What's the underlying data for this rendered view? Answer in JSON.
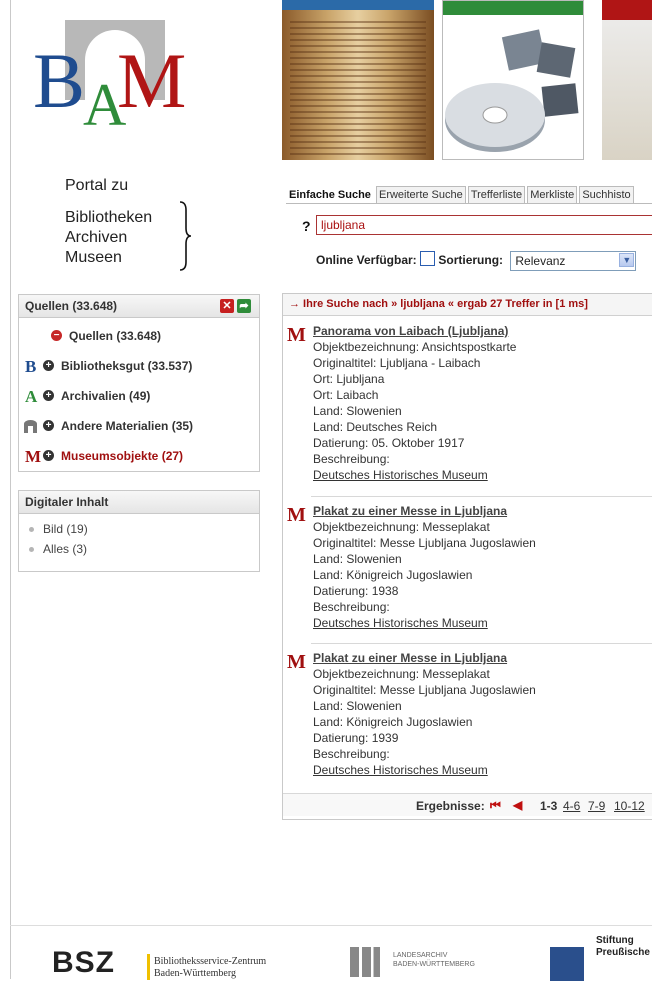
{
  "logo": {
    "text": "BAM"
  },
  "portal": {
    "line1": "Portal zu",
    "items": [
      "Bibliotheken",
      "Archiven",
      "Museen"
    ]
  },
  "tabs": [
    "Einfache Suche",
    "Erweiterte Suche",
    "Trefferliste",
    "Merkliste",
    "Suchhisto"
  ],
  "search": {
    "help": "?",
    "query": "ljubljana"
  },
  "options": {
    "online_label": "Online Verfügbar:",
    "sort_label": "Sortierung:",
    "sort_value": "Relevanz"
  },
  "sources": {
    "header": "Quellen (33.648)",
    "items": [
      {
        "letter": "",
        "label": "Quellen (33.648)"
      },
      {
        "letter": "B",
        "label": "Bibliotheksgut (33.537)"
      },
      {
        "letter": "A",
        "label": "Archivalien (49)"
      },
      {
        "letter": "",
        "label": "Andere Materialien (35)"
      },
      {
        "letter": "M",
        "label": "Museumsobjekte (27)"
      }
    ]
  },
  "digital": {
    "header": "Digitaler Inhalt",
    "items": [
      "Bild (19)",
      "Alles (3)"
    ]
  },
  "results_header": "→ Ihre Suche nach » ljubljana « ergab 27 Treffer in [1 ms]",
  "results": [
    {
      "title": "Panorama von Laibach (Ljubljana)",
      "lines": [
        "Objektbezeichnung: Ansichtspostkarte",
        "Originaltitel: Ljubljana - Laibach",
        "Ort: Ljubljana",
        "Ort: Laibach",
        "Land: Slowenien",
        "Land: Deutsches Reich",
        "Datierung: 05. Oktober 1917",
        "Beschreibung:"
      ],
      "link": "Deutsches Historisches Museum"
    },
    {
      "title": "Plakat zu einer Messe in Ljubljana",
      "lines": [
        "Objektbezeichnung: Messeplakat",
        "Originaltitel: Messe Ljubljana Jugoslawien",
        "Land: Slowenien",
        "Land: Königreich Jugoslawien",
        "Datierung: 1938",
        "Beschreibung:"
      ],
      "link": "Deutsches Historisches Museum"
    },
    {
      "title": "Plakat zu einer Messe in Ljubljana",
      "lines": [
        "Objektbezeichnung: Messeplakat",
        "Originaltitel: Messe Ljubljana Jugoslawien",
        "Land: Slowenien",
        "Land: Königreich Jugoslawien",
        "Datierung: 1939",
        "Beschreibung:"
      ],
      "link": "Deutsches Historisches Museum"
    }
  ],
  "pager": {
    "label": "Ergebnisse:",
    "pages": [
      "1-3",
      "4-6",
      "7-9",
      "10-12"
    ]
  },
  "footer": {
    "bsz_logo": "BSZ",
    "bsz_line1": "Bibliotheksservice-Zentrum",
    "bsz_line2": "Baden-Württemberg",
    "la_line1": "LANDESARCHIV",
    "la_line2": "BADEN-WÜRTTEMBERG",
    "spk_line1": "Stiftung",
    "spk_line2": "Preußische"
  }
}
